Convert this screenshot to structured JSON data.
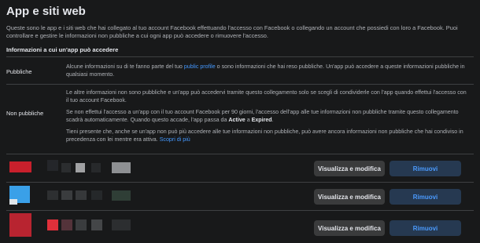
{
  "header": {
    "title": "App e siti web"
  },
  "intro": {
    "text": "Queste sono le app e i siti web che hai collegato al tuo account Facebook effettuando l'accesso con Facebook o collegando un account che possiedi con loro a Facebook. Puoi controllare e gestire le informazioni non pubbliche a cui ogni app può accedere o rimuovere l'accesso."
  },
  "info_section": {
    "heading": "Informazioni a cui un'app può accedere",
    "public_row": {
      "label": "Pubbliche",
      "text_before": "Alcune informazioni su di te fanno parte del tuo ",
      "link": "public profile",
      "text_after": " o sono informazioni che hai reso pubbliche. Un'app può accedere a queste informazioni pubbliche in qualsiasi momento."
    },
    "nonpublic_row": {
      "label": "Non pubbliche",
      "para1": "Le altre informazioni non sono pubbliche e un'app può accedervi tramite questo collegamento solo se scegli di condividerle con l'app quando effettui l'accesso con il tuo account Facebook.",
      "para2_before": "Se non effettui l'accesso a un'app con il tuo account Facebook per 90 giorni, l'accesso dell'app alle tue informazioni non pubbliche tramite questo collegamento scadrà automaticamente. Quando questo accade, l'app passa da ",
      "para2_active": "Active",
      "para2_mid": " a ",
      "para2_expired": "Expired",
      "para2_after": ".",
      "para3_before": "Tieni presente che, anche se un'app non può più accedere alle tue informazioni non pubbliche, può avere ancora informazioni non pubbliche che hai condiviso in precedenza con lei mentre era attiva. ",
      "para3_link": "Scopri di più"
    }
  },
  "apps": [
    {
      "edit_label": "Visualizza e modifica",
      "remove_label": "Rimuovi",
      "blurred_cells": [
        "#c8202c",
        "#24262a",
        "#2b2d2f",
        "#a0a1a3",
        "#27292b",
        "#8e9093",
        "#24262a",
        "#0f3418",
        "#2e2f31"
      ]
    },
    {
      "edit_label": "Visualizza e modifica",
      "remove_label": "Rimuovi",
      "blurred_cells": [
        "#3aa0e8",
        "#dfe5ea",
        "#2d2f31",
        "#3a3c3e",
        "#36383a",
        "#25282a",
        "#2f3e36",
        "#1b5c35",
        "#2a2c2e"
      ]
    },
    {
      "edit_label": "Visualizza e modifica",
      "remove_label": "Rimuovi",
      "blurred_cells": [
        "#b82430",
        "#e0303a",
        "#54333a",
        "#3a3c3e",
        "#444648",
        "#2c2e30",
        "#3d3f41",
        "#2d2f31",
        "#4c4e50"
      ]
    }
  ]
}
